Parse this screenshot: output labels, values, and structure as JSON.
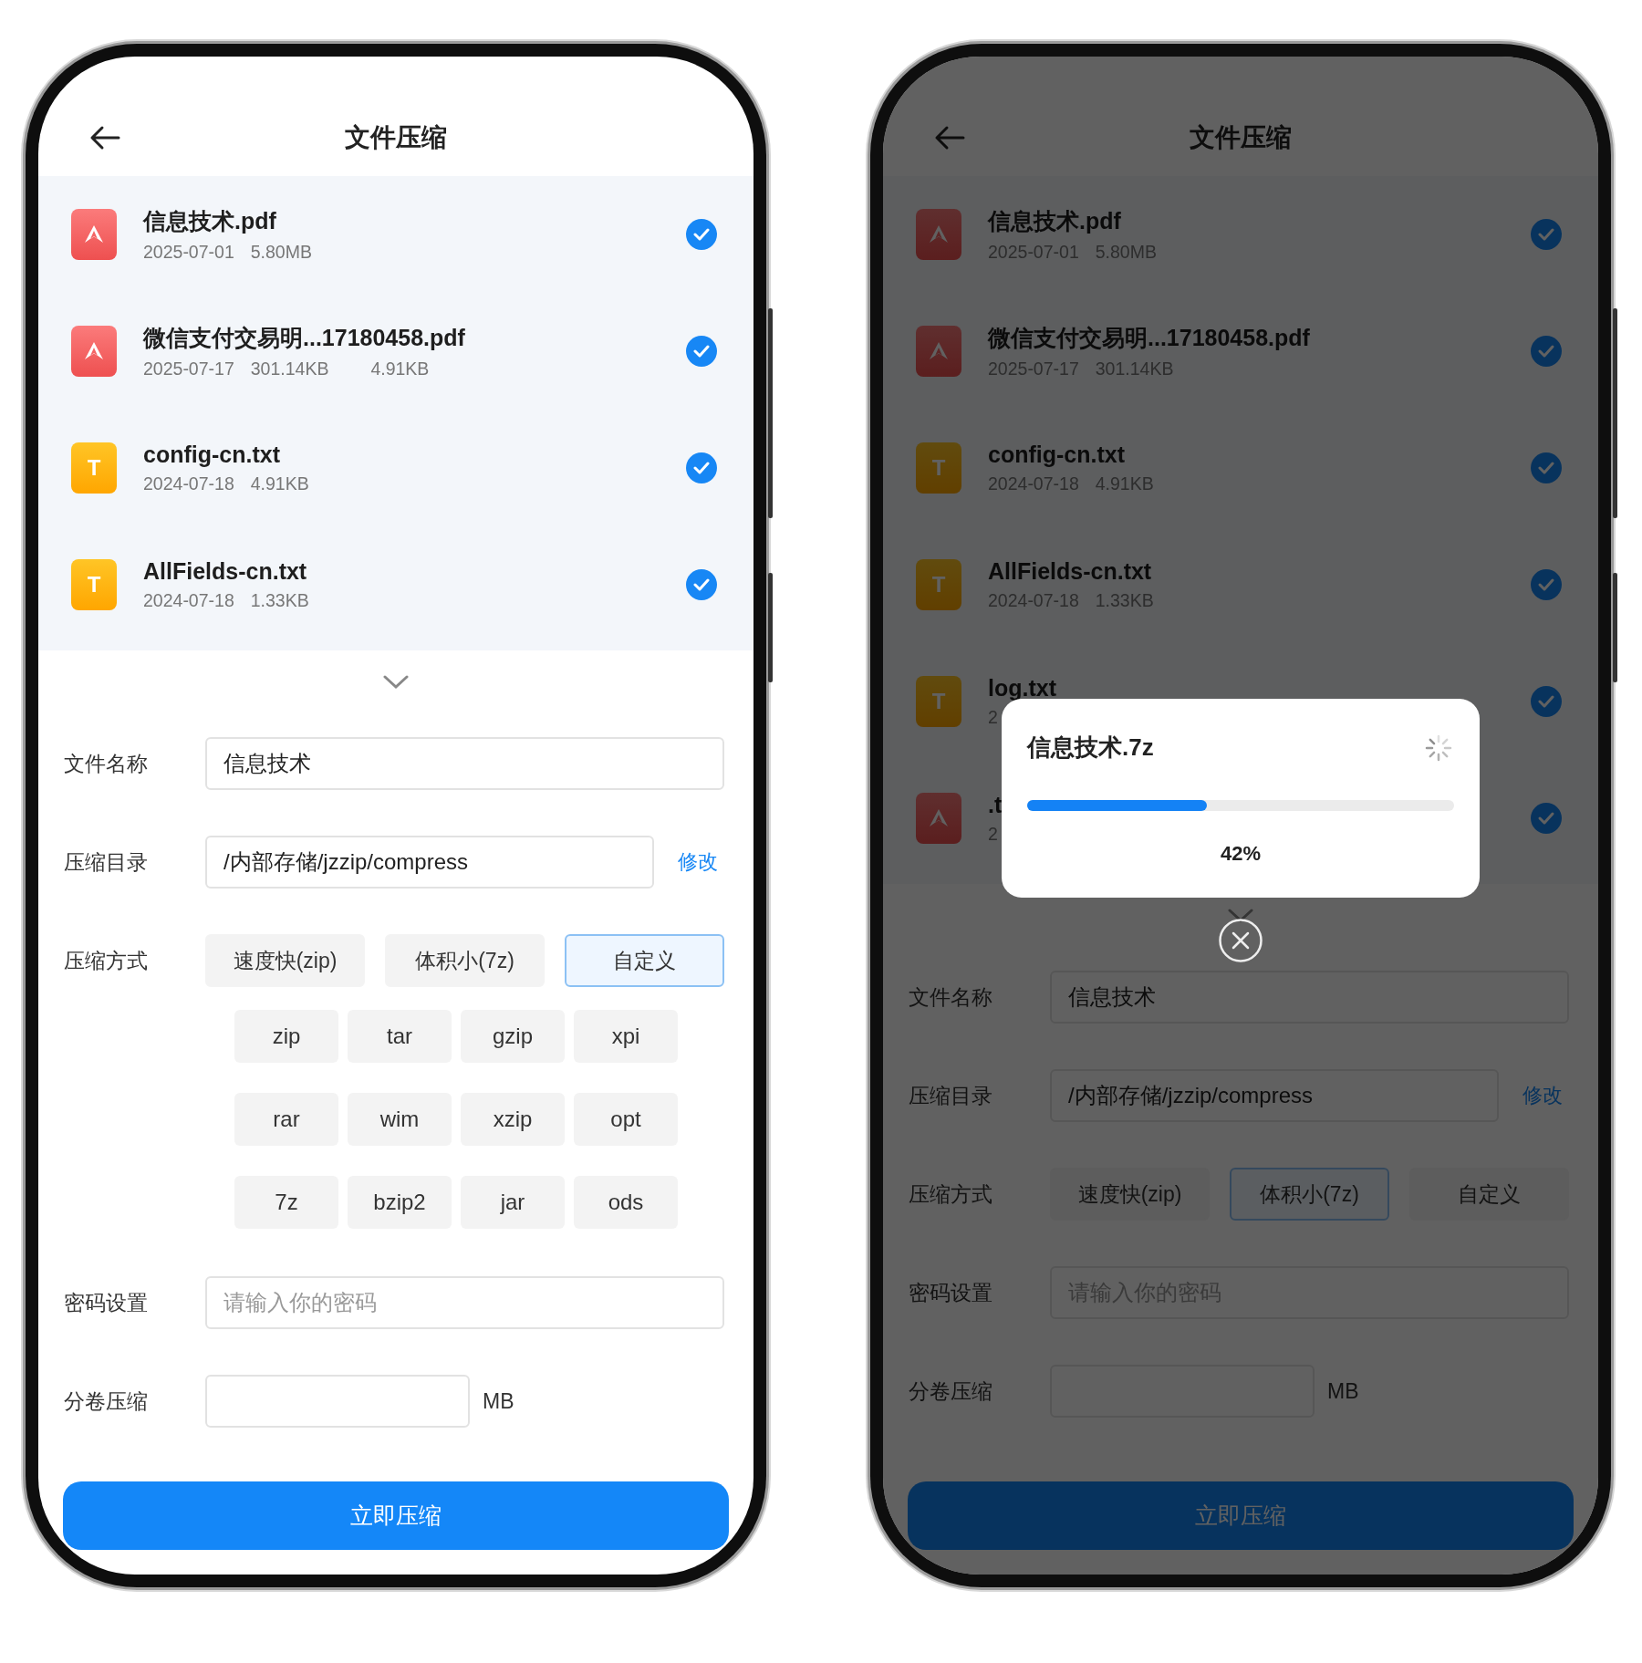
{
  "screens": [
    {
      "title": "文件压缩",
      "files": [
        {
          "kind": "pdf",
          "name": "信息技术.pdf",
          "meta": [
            "2025-07-01",
            "5.80MB"
          ],
          "checked": true
        },
        {
          "kind": "pdf",
          "name": "微信支付交易明...17180458.pdf",
          "meta": [
            "2025-07-17",
            "301.14KB",
            "4.91KB"
          ],
          "checked": true
        },
        {
          "kind": "txt",
          "badge": "T",
          "name": "config-cn.txt",
          "meta": [
            "2024-07-18",
            "4.91KB"
          ],
          "checked": true
        },
        {
          "kind": "txt",
          "badge": "T",
          "name": "AllFields-cn.txt",
          "meta": [
            "2024-07-18",
            "1.33KB"
          ],
          "checked": true
        }
      ],
      "form": {
        "name_label": "文件名称",
        "name_value": "信息技术",
        "dir_label": "压缩目录",
        "dir_value": "/内部存储/jzzip/compress",
        "dir_link": "修改",
        "method_label": "压缩方式",
        "methods": [
          {
            "label": "速度快(zip)",
            "selected": false
          },
          {
            "label": "体积小(7z)",
            "selected": false
          },
          {
            "label": "自定义",
            "selected": true
          }
        ],
        "formats": [
          "zip",
          "tar",
          "gzip",
          "xpi",
          "rar",
          "wim",
          "xzip",
          "opt",
          "7z",
          "bzip2",
          "jar",
          "ods"
        ],
        "password_label": "密码设置",
        "password_placeholder": "请输入你的密码",
        "split_label": "分卷压缩",
        "split_unit": "MB"
      },
      "submit": "立即压缩"
    },
    {
      "title": "文件压缩",
      "files": [
        {
          "kind": "pdf",
          "name": "信息技术.pdf",
          "meta": [
            "2025-07-01",
            "5.80MB"
          ],
          "checked": true
        },
        {
          "kind": "pdf",
          "name": "微信支付交易明...17180458.pdf",
          "meta": [
            "2025-07-17",
            "301.14KB"
          ],
          "checked": true
        },
        {
          "kind": "txt",
          "badge": "T",
          "name": "config-cn.txt",
          "meta": [
            "2024-07-18",
            "4.91KB"
          ],
          "checked": true
        },
        {
          "kind": "txt",
          "badge": "T",
          "name": "AllFields-cn.txt",
          "meta": [
            "2024-07-18",
            "1.33KB"
          ],
          "checked": true
        },
        {
          "kind": "txt",
          "badge": "T",
          "name": "log.txt",
          "meta": [
            "2"
          ],
          "checked": true
        },
        {
          "kind": "pdf",
          "name": ".t",
          "meta": [
            "2"
          ],
          "checked": true
        }
      ],
      "form": {
        "name_label": "文件名称",
        "name_value": "信息技术",
        "dir_label": "压缩目录",
        "dir_value": "/内部存储/jzzip/compress",
        "dir_link": "修改",
        "method_label": "压缩方式",
        "methods": [
          {
            "label": "速度快(zip)",
            "selected": false
          },
          {
            "label": "体积小(7z)",
            "selected": true
          },
          {
            "label": "自定义",
            "selected": false
          }
        ],
        "password_label": "密码设置",
        "password_placeholder": "请输入你的密码",
        "split_label": "分卷压缩",
        "split_unit": "MB"
      },
      "submit": "立即压缩",
      "dialog": {
        "title": "信息技术.7z",
        "level": 0.42,
        "percent": "42%"
      }
    }
  ]
}
